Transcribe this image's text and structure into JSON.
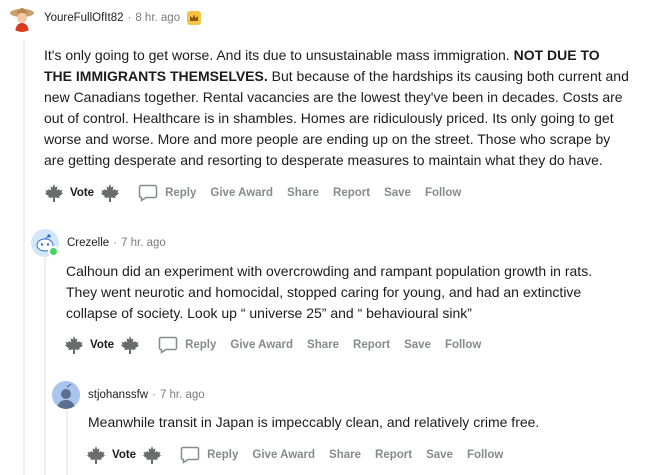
{
  "colors": {
    "meta_gray": "#7c7c7c",
    "action_gray": "#878a8c",
    "thread_line": "#edeff1",
    "online": "#46d160"
  },
  "comments": [
    {
      "username": "YoureFullOfIt82",
      "time": "8 hr. ago",
      "badge_icon": "award-crown-icon",
      "lines": [
        "It's only going to get worse. And its due to unsustainable mass immigration. ",
        "THE IMMIGRANTS THEMSELVES.",
        " But because of the hardships its causing both current and",
        "new Canadians together. Rental vacancies are the lowest they've been in decades. Costs are",
        "out of control. Healthcare is in shambles. Homes are ridiculously priced. Its only going to get",
        "worse and worse. More and more people are ending up on the street. Those who scrape by",
        "are getting desperate and resorting to desperate measures to maintain what they do have."
      ],
      "bold_segment": "NOT DUE TO",
      "actions": {
        "vote": "Vote",
        "reply": "Reply",
        "award": "Give Award",
        "share": "Share",
        "report": "Report",
        "save": "Save",
        "follow": "Follow"
      }
    },
    {
      "username": "Crezelle",
      "time": "7 hr. ago",
      "lines": [
        "Calhoun did an experiment with overcrowding and rampant population growth in rats.",
        "They went neurotic and homocidal, stopped caring for young, and had an extinctive",
        "collapse of society. Look up “ universe 25” and “ behavioural sink”"
      ],
      "actions": {
        "vote": "Vote",
        "reply": "Reply",
        "award": "Give Award",
        "share": "Share",
        "report": "Report",
        "save": "Save",
        "follow": "Follow"
      }
    },
    {
      "username": "stjohanssfw",
      "time": "7 hr. ago",
      "lines": [
        "Meanwhile transit in Japan is impeccably clean, and relatively crime free."
      ],
      "actions": {
        "vote": "Vote",
        "reply": "Reply",
        "award": "Give Award",
        "share": "Share",
        "report": "Report",
        "save": "Save",
        "follow": "Follow"
      }
    }
  ],
  "separator": "·"
}
